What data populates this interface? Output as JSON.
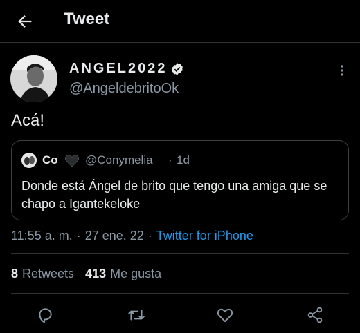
{
  "header": {
    "title": "Tweet",
    "back_icon": "arrow-left-icon"
  },
  "tweet": {
    "display_name": "ANGEL2022",
    "handle": "@AngeldebritoOk",
    "text": "Acá!",
    "timestamp": "11:55 a. m.",
    "date": "27 ene. 22",
    "source": "Twitter for iPhone",
    "separator": "·"
  },
  "quote": {
    "name": "Co",
    "handle": "@Conymelia",
    "separator": "·",
    "time": "1d",
    "text": "Donde está Ángel de brito  que tengo una amiga que se chapo a Igantekeloke"
  },
  "stats": {
    "retweets_count": "8",
    "retweets_label": "Retweets",
    "likes_count": "413",
    "likes_label": "Me gusta"
  },
  "actions": [
    "reply-icon",
    "retweet-icon",
    "like-icon",
    "share-icon"
  ],
  "colors": {
    "background": "#000000",
    "text": "#e7e9ea",
    "secondary": "#8b98a5",
    "link": "#1d9bf0",
    "border": "#2f3336"
  }
}
